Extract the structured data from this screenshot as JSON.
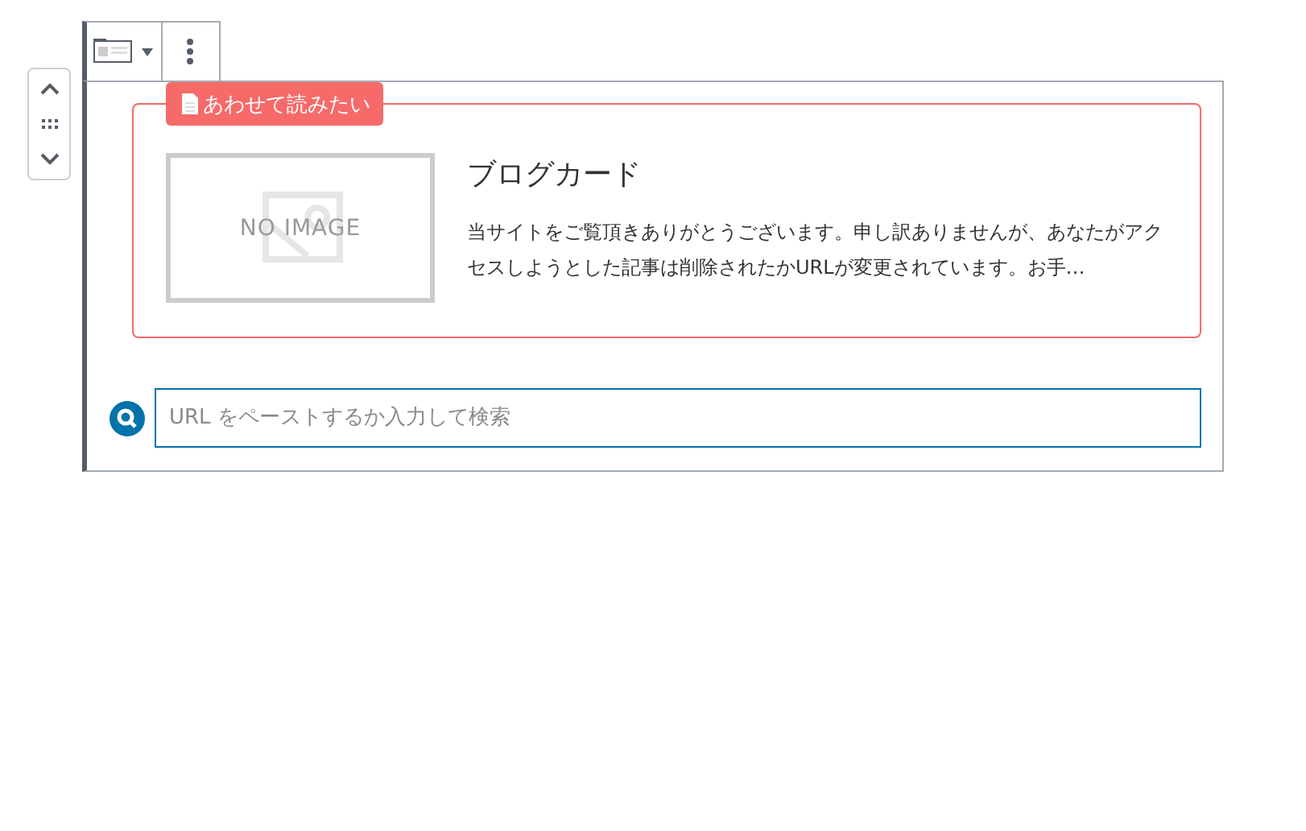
{
  "card": {
    "label": "あわせて読みたい",
    "image_text": "NO IMAGE",
    "title": "ブログカード",
    "excerpt": "当サイトをご覧頂きありがとうございます。申し訳ありませんが、あなたがアクセスしようとした記事は削除されたかURLが変更されています。お手…"
  },
  "search": {
    "placeholder": "URL をペーストするか入力して検索"
  }
}
